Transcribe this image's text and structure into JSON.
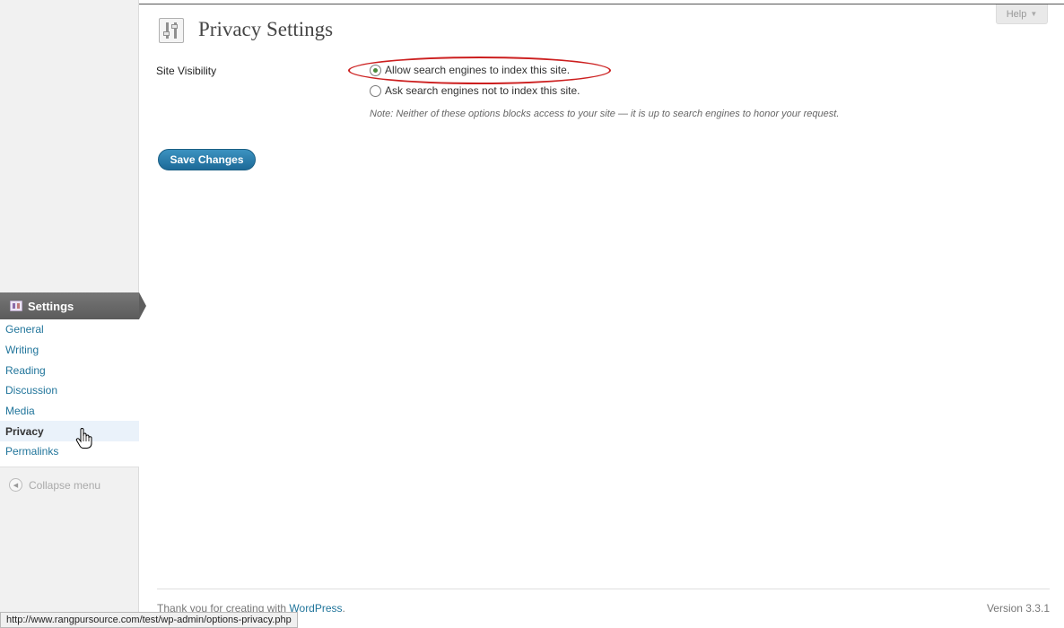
{
  "header": {
    "help_label": "Help"
  },
  "page": {
    "title": "Privacy Settings"
  },
  "form": {
    "row_label": "Site Visibility",
    "options": [
      {
        "label": "Allow search engines to index this site.",
        "checked": true
      },
      {
        "label": "Ask search engines not to index this site.",
        "checked": false
      }
    ],
    "note": "Note: Neither of these options blocks access to your site — it is up to search engines to honor your request.",
    "save_label": "Save Changes"
  },
  "sidebar": {
    "section_label": "Settings",
    "items": [
      {
        "label": "General"
      },
      {
        "label": "Writing"
      },
      {
        "label": "Reading"
      },
      {
        "label": "Discussion"
      },
      {
        "label": "Media"
      },
      {
        "label": "Privacy",
        "current": true
      },
      {
        "label": "Permalinks"
      }
    ],
    "collapse_label": "Collapse menu"
  },
  "footer": {
    "thanks_prefix": "Thank you for creating with ",
    "thanks_link": "WordPress",
    "thanks_suffix": ".",
    "version": "Version 3.3.1"
  },
  "status_bar": {
    "url": "http://www.rangpursource.com/test/wp-admin/options-privacy.php"
  },
  "icons": {
    "page": "settings-sliders-icon",
    "menu": "settings-menu-icon",
    "collapse": "collapse-arrow-icon",
    "cursor": "hand-pointer-cursor-icon"
  },
  "colors": {
    "accent_link": "#21759b",
    "button": "#21759b",
    "highlight": "#cc1f1f",
    "menu_header": "#5b5b5b"
  }
}
